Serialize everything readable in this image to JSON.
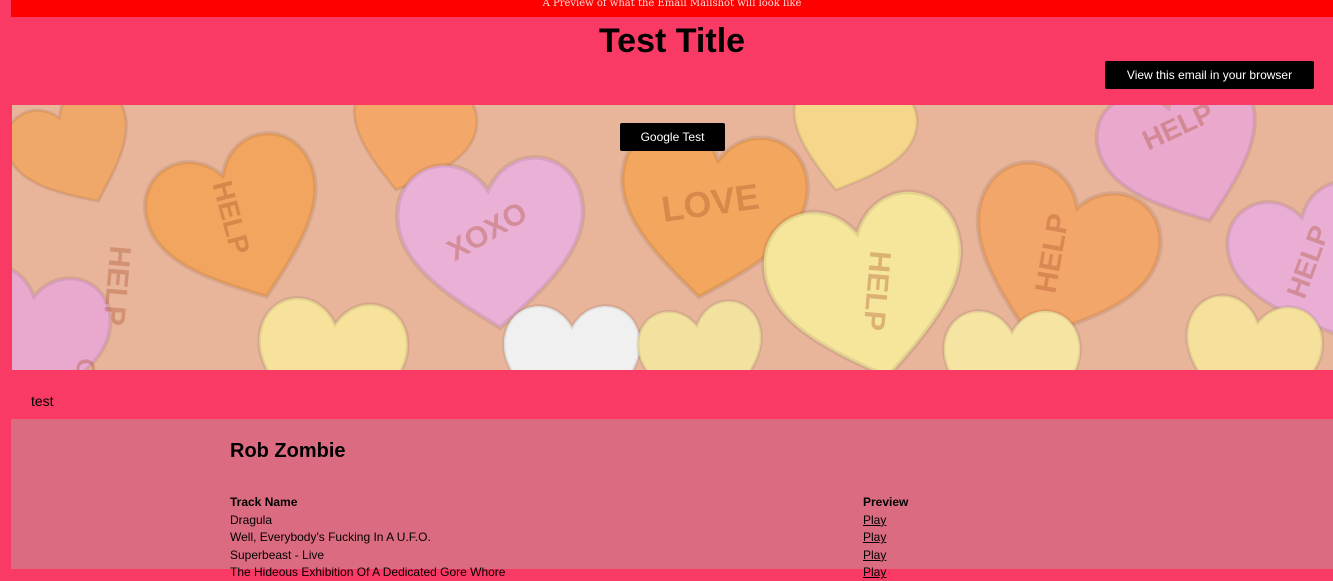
{
  "preview_notice": "A Preview of what the Email Mailshot will look like",
  "title": "Test Title",
  "view_browser_label": "View this email in your browser",
  "hero": {
    "button_label": "Google Test",
    "image": "candy-hearts",
    "heart_texts": [
      "HELP",
      "XOXO",
      "HELP",
      "XOXO",
      "LOVE",
      "HELP",
      "HELP",
      "HELP",
      "HELP"
    ]
  },
  "intro_text": "test",
  "artist": "Rob Zombie",
  "tracks": {
    "headers": [
      "Track Name",
      "Preview"
    ],
    "rows": [
      {
        "name": "Dragula",
        "preview": "Play"
      },
      {
        "name": "Well, Everybody's Fucking In A U.F.O.",
        "preview": "Play"
      },
      {
        "name": "Superbeast - Live",
        "preview": "Play"
      },
      {
        "name": "The Hideous Exhibition Of A Dedicated Gore Whore",
        "preview": "Play"
      }
    ]
  },
  "colors": {
    "background": "#f83a64",
    "preview_bar": "#ff0000",
    "panel": "#db6b80",
    "button": "#000000"
  }
}
